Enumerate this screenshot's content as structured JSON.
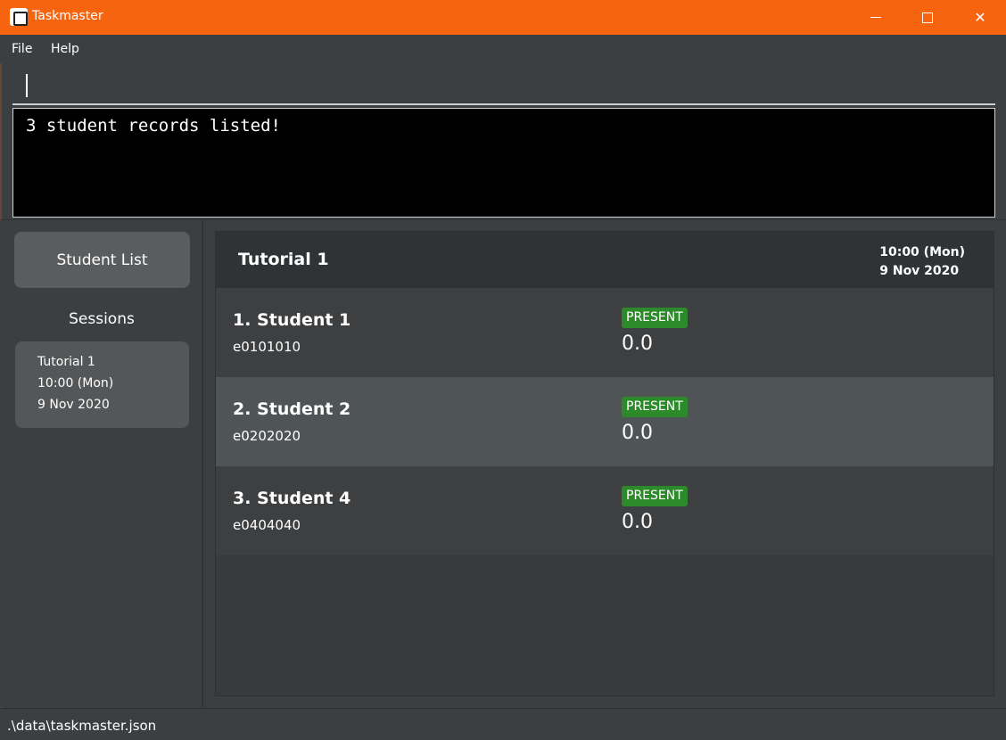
{
  "window": {
    "title": "Taskmaster",
    "accent_color": "#f7640f",
    "controls": {
      "minimize": "minimize-icon",
      "maximize": "maximize-icon",
      "close": "close-icon"
    }
  },
  "menu": {
    "file": "File",
    "help": "Help"
  },
  "command_box": {
    "value": ""
  },
  "result": {
    "message": "3 student records listed!"
  },
  "sidebar": {
    "student_list_label": "Student List",
    "sessions_title": "Sessions",
    "sessions": [
      {
        "name": "Tutorial 1",
        "time": "10:00 (Mon)",
        "date": "9 Nov 2020"
      }
    ]
  },
  "session": {
    "title": "Tutorial 1",
    "time": "10:00 (Mon)",
    "date": "9 Nov 2020"
  },
  "records": [
    {
      "name": "1.  Student 1",
      "id": "e0101010",
      "status": "PRESENT",
      "score": "0.0"
    },
    {
      "name": "2.  Student 2",
      "id": "e0202020",
      "status": "PRESENT",
      "score": "0.0"
    },
    {
      "name": "3.  Student 4",
      "id": "e0404040",
      "status": "PRESENT",
      "score": "0.0"
    }
  ],
  "status_bar": {
    "path": ".\\data\\taskmaster.json"
  },
  "colors": {
    "present_badge": "#2c8a2a",
    "result_background": "#000000"
  }
}
